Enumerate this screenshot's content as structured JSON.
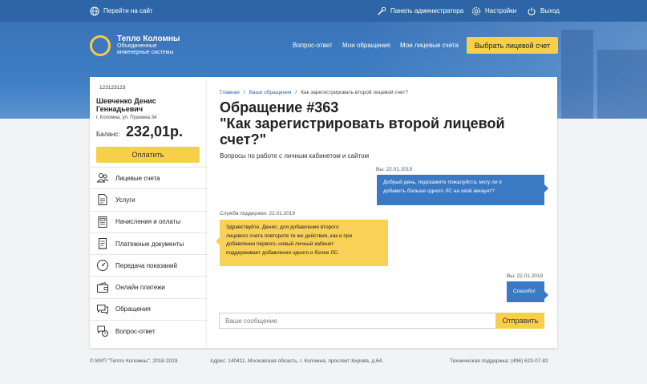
{
  "topbar": {
    "goto_site": "Перейти на сайт",
    "admin_panel": "Панель администратора",
    "settings": "Настройки",
    "logout": "Выход"
  },
  "brand": {
    "title": "Тепло Коломны",
    "subtitle_line1": "Объединенные",
    "subtitle_line2": "инженерные системы"
  },
  "nav": {
    "items": [
      "Вопрос-ответ",
      "Мои обращения",
      "Мои лицевые счета"
    ],
    "cta": "Выбрать лицевой счет"
  },
  "account": {
    "number": "123123123",
    "name": "Шевченко Денис Геннадьевич",
    "address": "г. Коломна, ул. Пушкина 34",
    "balance_label": "Баланс:",
    "balance_value": "232,01р.",
    "pay_label": "Оплатить"
  },
  "menu": [
    {
      "label": "Лицевые счета",
      "icon": "users-icon"
    },
    {
      "label": "Услуги",
      "icon": "document-icon"
    },
    {
      "label": "Начисления и оплаты",
      "icon": "calculator-icon"
    },
    {
      "label": "Платежные документы",
      "icon": "receipt-icon"
    },
    {
      "label": "Передача показаний",
      "icon": "meter-icon"
    },
    {
      "label": "Онлайн платежи",
      "icon": "wallet-icon"
    },
    {
      "label": "Обращения",
      "icon": "chat-icon"
    },
    {
      "label": "Вопрос-ответ",
      "icon": "question-icon"
    }
  ],
  "breadcrumbs": {
    "home": "Главная",
    "requests": "Ваши обращения",
    "current": "Как зарегистрировать второй лицевой счет?",
    "sep": "/"
  },
  "ticket": {
    "title_line1": "Обращение #363",
    "title_line2": "\"Как зарегистрировать второй лицевой",
    "title_line3": "счет?\"",
    "category": "Вопросы по работе с личным кабинетом и сайтом"
  },
  "messages": [
    {
      "meta": "Вы: 22.01.2019",
      "line1": "Добрый день, подскажите пожалуйста, могу ли я",
      "line2": "добавить больше одного ЛС на свой аккаунт?"
    },
    {
      "meta": "Служба поддержки: 22.01.2019",
      "line1": "Здравствуйте, Денис, для добавления второго",
      "line2": "лицевого счета повторите те же действия, как и при",
      "line3": "добавлении первого, новый личный кабинет",
      "line4": "поддерживает добавления одного и более ЛС."
    },
    {
      "meta": "Вы: 22.01.2019",
      "line1": "Спасибо!"
    }
  ],
  "composer": {
    "placeholder": "Ваше сообщение",
    "send": "Отправить"
  },
  "footer": {
    "copyright": "© МУП \"Тепло Коломны\", 2018-2019.",
    "address": "Адрес: 140411, Московская область, г. Коломна, проспект Кирова, д.64.",
    "support": "Техническая поддержка: (496) 623-07-82"
  }
}
